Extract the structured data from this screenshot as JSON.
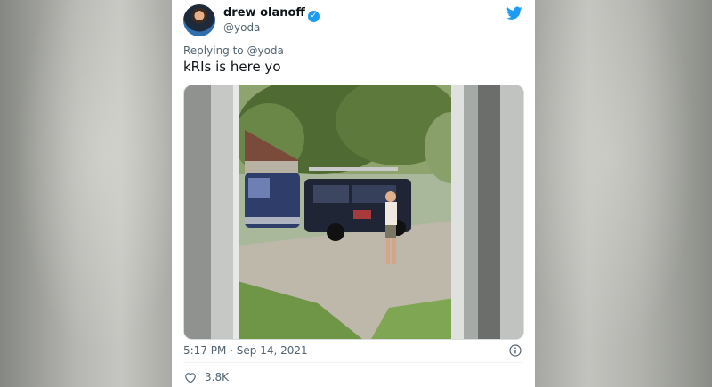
{
  "tweet": {
    "display_name": "drew olanoff",
    "handle": "@yoda",
    "replying_to_prefix": "Replying to",
    "replying_to_handle": "@yoda",
    "text": "kRIs is here yo",
    "timestamp": "5:17 PM · Sep 14, 2021",
    "like_count": "3.8K"
  },
  "icons": {
    "verified": "verified-badge-icon",
    "brand": "twitter-bird-icon",
    "info": "info-icon",
    "like": "heart-icon"
  },
  "colors": {
    "twitter_blue": "#1d9bf0",
    "text_primary": "#0f1419",
    "text_secondary": "#536471"
  }
}
